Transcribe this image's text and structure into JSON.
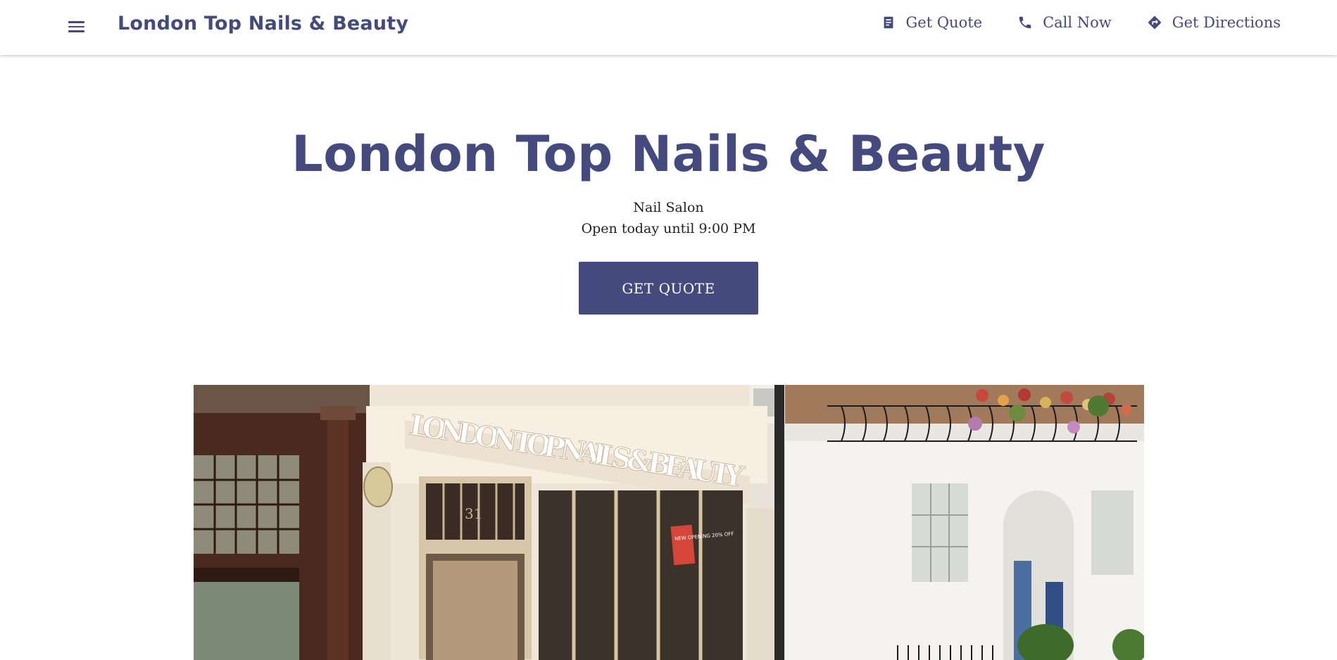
{
  "header": {
    "brand": "London Top Nails & Beauty",
    "actions": [
      {
        "label": "Get Quote",
        "icon": "receipt-icon"
      },
      {
        "label": "Call Now",
        "icon": "phone-icon"
      },
      {
        "label": "Get Directions",
        "icon": "directions-icon"
      }
    ]
  },
  "hero": {
    "title": "London Top Nails & Beauty",
    "category": "Nail Salon",
    "hours": "Open today until 9:00 PM",
    "cta_label": "GET QUOTE"
  },
  "photo": {
    "sign_text": "LONDON TOP NAILS & BEAUTY",
    "door_number": "31",
    "window_sign": "NEW OPENING 20% OFF"
  },
  "colors": {
    "brand": "#444a7e",
    "text": "#222222",
    "background": "#ffffff"
  }
}
